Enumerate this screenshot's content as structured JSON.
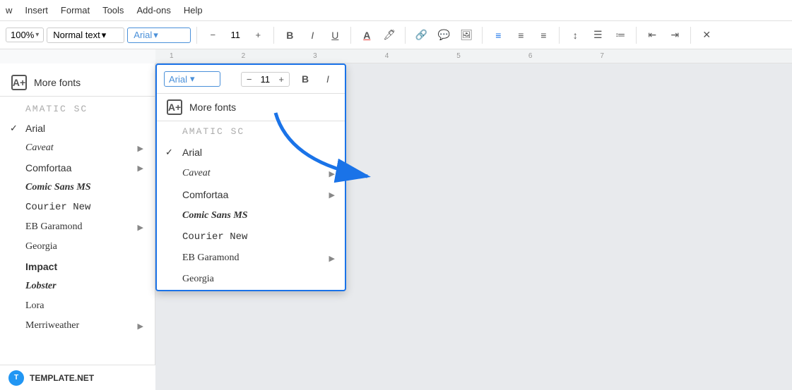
{
  "menubar": {
    "items": [
      "w",
      "Insert",
      "Format",
      "Tools",
      "Add-ons",
      "Help"
    ]
  },
  "toolbar": {
    "zoom": "100%",
    "zoom_arrow": "▾",
    "style": "Normal text",
    "style_arrow": "▾",
    "font": "Arial",
    "font_arrow": "▾",
    "font_size": "11",
    "bold": "B",
    "italic": "I",
    "underline": "U"
  },
  "ruler": {
    "marks": [
      "1",
      "2",
      "3",
      "4",
      "5",
      "6",
      "7"
    ]
  },
  "sidebar": {
    "more_fonts_label": "More fonts",
    "more_fonts_icon": "A+",
    "fonts": [
      {
        "name": "Amatic SC",
        "style": "amatic",
        "checked": false,
        "has_arrow": false
      },
      {
        "name": "Arial",
        "style": "arial",
        "checked": true,
        "has_arrow": false
      },
      {
        "name": "Caveat",
        "style": "caveat",
        "checked": false,
        "has_arrow": true
      },
      {
        "name": "Comfortaa",
        "style": "comfortaa",
        "checked": false,
        "has_arrow": true
      },
      {
        "name": "Comic Sans MS",
        "style": "comic",
        "checked": false,
        "has_arrow": false
      },
      {
        "name": "Courier New",
        "style": "courier",
        "checked": false,
        "has_arrow": false
      },
      {
        "name": "EB Garamond",
        "style": "eb",
        "checked": false,
        "has_arrow": true
      },
      {
        "name": "Georgia",
        "style": "georgia",
        "checked": false,
        "has_arrow": false
      },
      {
        "name": "Impact",
        "style": "impact",
        "checked": false,
        "has_arrow": false
      },
      {
        "name": "Lobster",
        "style": "lobster",
        "checked": false,
        "has_arrow": false
      },
      {
        "name": "Lora",
        "style": "lora",
        "checked": false,
        "has_arrow": false
      },
      {
        "name": "Merriweather",
        "style": "merri",
        "checked": false,
        "has_arrow": true
      }
    ]
  },
  "dropdown": {
    "font": "Arial",
    "font_arrow": "▾",
    "font_size": "11",
    "bold": "B",
    "italic": "I",
    "more_fonts_label": "More fonts",
    "more_fonts_icon": "A+",
    "fonts": [
      {
        "name": "AMATIC SC",
        "style": "amatic",
        "checked": false,
        "has_arrow": false
      },
      {
        "name": "Arial",
        "style": "arial",
        "checked": true,
        "has_arrow": false
      },
      {
        "name": "Caveat",
        "style": "caveat",
        "checked": false,
        "has_arrow": true
      },
      {
        "name": "Comfortaa",
        "style": "comfortaa",
        "checked": false,
        "has_arrow": true
      },
      {
        "name": "Comic Sans MS",
        "style": "comic",
        "checked": false,
        "has_arrow": false
      },
      {
        "name": "Courier New",
        "style": "courier",
        "checked": false,
        "has_arrow": false
      },
      {
        "name": "EB Garamond",
        "style": "eb",
        "checked": false,
        "has_arrow": true
      },
      {
        "name": "Georgia",
        "style": "georgia",
        "checked": false,
        "has_arrow": false
      }
    ]
  },
  "branding": {
    "logo": "T",
    "name": "TEMPLATE.NET"
  },
  "annotation": {
    "arrow_color": "#1a73e8"
  }
}
